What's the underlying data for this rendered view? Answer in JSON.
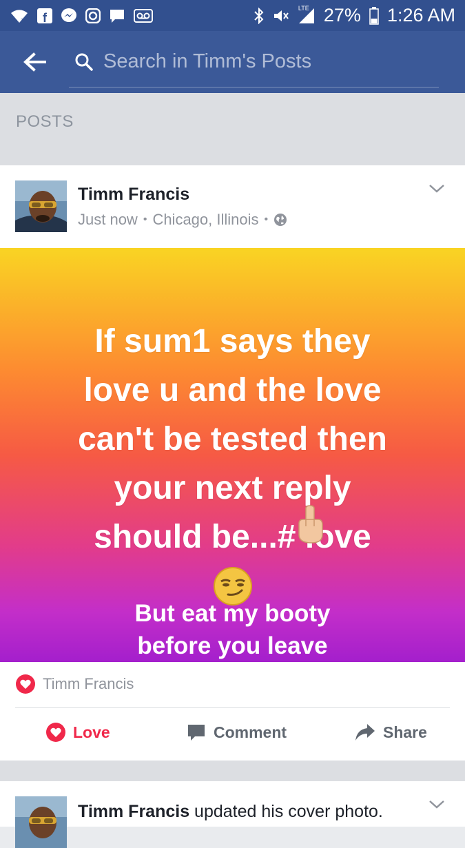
{
  "status_bar": {
    "battery": "27%",
    "time": "1:26 AM",
    "network": "LTE",
    "left_icons": [
      "wifi-icon",
      "facebook-icon",
      "messenger-icon",
      "instagram-icon",
      "chat-icon",
      "voicemail-icon"
    ],
    "right_icons": [
      "bluetooth-icon",
      "mute-icon",
      "signal-icon",
      "battery-icon"
    ]
  },
  "app_bar": {
    "search_placeholder": "Search in Timm's Posts",
    "colors": {
      "bar": "#3b5998",
      "status": "#32508f"
    }
  },
  "section": {
    "title": "POSTS"
  },
  "post": {
    "author": "Timm Francis",
    "time": "Just now",
    "location": "Chicago, Illinois",
    "dot": "•",
    "audience_icon": "globe-icon",
    "banner_lines": [
      "If sum1 says they",
      "love u and the love",
      "can't be tested then",
      "your next reply",
      "should be...# love"
    ],
    "banner_emojis": [
      "middle-finger-emoji",
      "smirk-emoji"
    ],
    "banner_sub_lines": [
      "But eat my booty",
      "before you leave"
    ],
    "reaction_name": "Timm Francis",
    "actions": {
      "love": "Love",
      "comment": "Comment",
      "share": "Share"
    },
    "colors": {
      "love": "#f0284a",
      "gradient_top": "#f9d423",
      "gradient_bottom": "#a41fcc"
    }
  },
  "post2": {
    "author": "Timm Francis",
    "action_text": " updated his cover photo."
  }
}
